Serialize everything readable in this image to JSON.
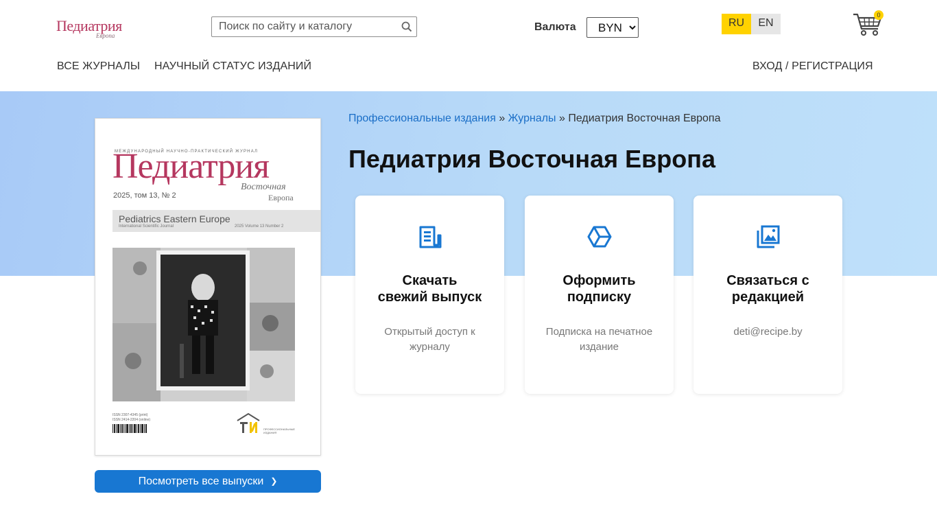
{
  "header": {
    "logo_text": "Педиатрия",
    "logo_sub": "Европа",
    "search_placeholder": "Поиск по сайту и каталогу",
    "currency_label": "Валюта",
    "currency_value": "BYN",
    "lang_ru": "RU",
    "lang_en": "EN",
    "cart_count": "0",
    "nav_all": "ВСЕ ЖУРНАЛЫ",
    "nav_status": "НАУЧНЫЙ СТАТУС ИЗДАНИЙ",
    "nav_login": "ВХОД / РЕГИСТРАЦИЯ"
  },
  "breadcrumb": {
    "item1": "Профессиональные издания",
    "sep": " » ",
    "item2": "Журналы",
    "current": "Педиатрия Восточная Европа"
  },
  "page_title": "Педиатрия Восточная Европа",
  "cover": {
    "top_line": "МЕЖДУНАРОДНЫЙ НАУЧНО-ПРАКТИЧЕСКИЙ ЖУРНАЛ",
    "title": "Педиатрия",
    "vostoch": "Восточная",
    "europa": "Европа",
    "issue": "2025, том 13, № 2",
    "en_title": "Pediatrics  Eastern Europe",
    "en_sub": "International Scientific Journal",
    "en_num": "2025   Volume 13   Number 2",
    "issn1": "ISSN 2307-4345 (print)",
    "issn2": "ISSN 2414-2204 (online)",
    "publisher": "ПРОФЕССИОНАЛЬНЫЕ ИЗДАНИЯ"
  },
  "view_all_button": "Посмотреть все выпуски",
  "cards": [
    {
      "title": "Скачать\nсвежий выпуск",
      "desc": "Открытый доступ к журналу",
      "icon": "document-icon"
    },
    {
      "title": "Оформить\nподписку",
      "desc": "Подписка на печатное издание",
      "icon": "cube-icon"
    },
    {
      "title": "Связаться с\nредакцией",
      "desc": "deti@recipe.by",
      "icon": "image-gallery-icon"
    }
  ],
  "colors": {
    "accent_blue": "#1877d2",
    "link_blue": "#1a6ec7",
    "brand_pink": "#b5375f",
    "lang_active": "#ffd200"
  }
}
